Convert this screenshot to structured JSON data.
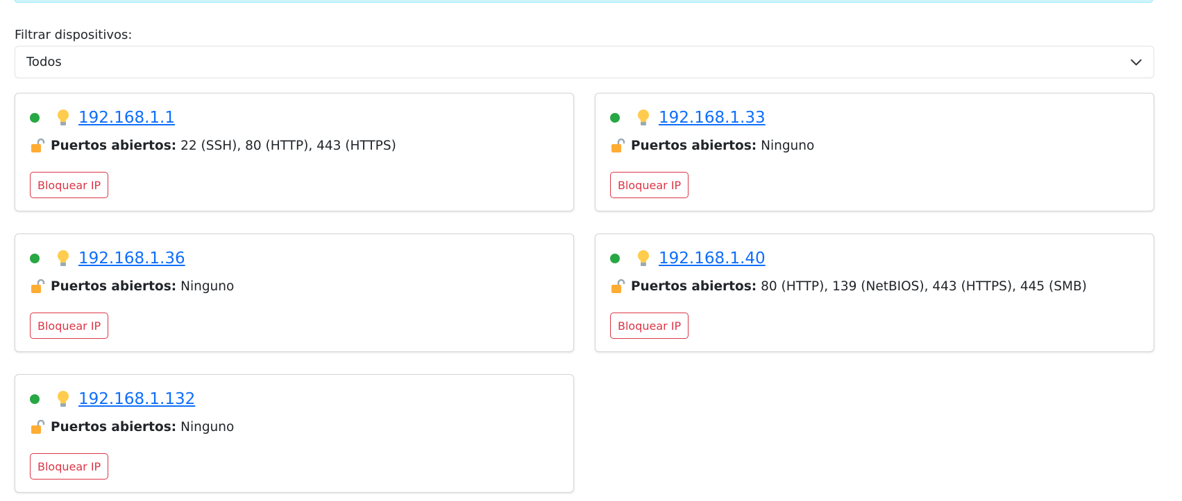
{
  "filter": {
    "label": "Filtrar dispositivos:",
    "selected": "Todos"
  },
  "devices": [
    {
      "ip": "192.168.1.1",
      "ports_label": "Puertos abiertos:",
      "ports": "22 (SSH), 80 (HTTP), 443 (HTTPS)",
      "block_label": "Bloquear IP",
      "status": "online"
    },
    {
      "ip": "192.168.1.33",
      "ports_label": "Puertos abiertos:",
      "ports": "Ninguno",
      "block_label": "Bloquear IP",
      "status": "online"
    },
    {
      "ip": "192.168.1.36",
      "ports_label": "Puertos abiertos:",
      "ports": "Ninguno",
      "block_label": "Bloquear IP",
      "status": "online"
    },
    {
      "ip": "192.168.1.40",
      "ports_label": "Puertos abiertos:",
      "ports": "80 (HTTP), 139 (NetBIOS), 443 (HTTPS), 445 (SMB)",
      "block_label": "Bloquear IP",
      "status": "online"
    },
    {
      "ip": "192.168.1.132",
      "ports_label": "Puertos abiertos:",
      "ports": "Ninguno",
      "block_label": "Bloquear IP",
      "status": "online"
    }
  ],
  "icons": {
    "status": "green-dot-icon",
    "device": "lightbulb-icon",
    "ports": "open-lock-icon",
    "dropdown": "chevron-down-icon"
  },
  "colors": {
    "online": "#28a745",
    "link": "#0d6efd",
    "danger": "#dc3545",
    "info_alert": "#cff4fc"
  }
}
